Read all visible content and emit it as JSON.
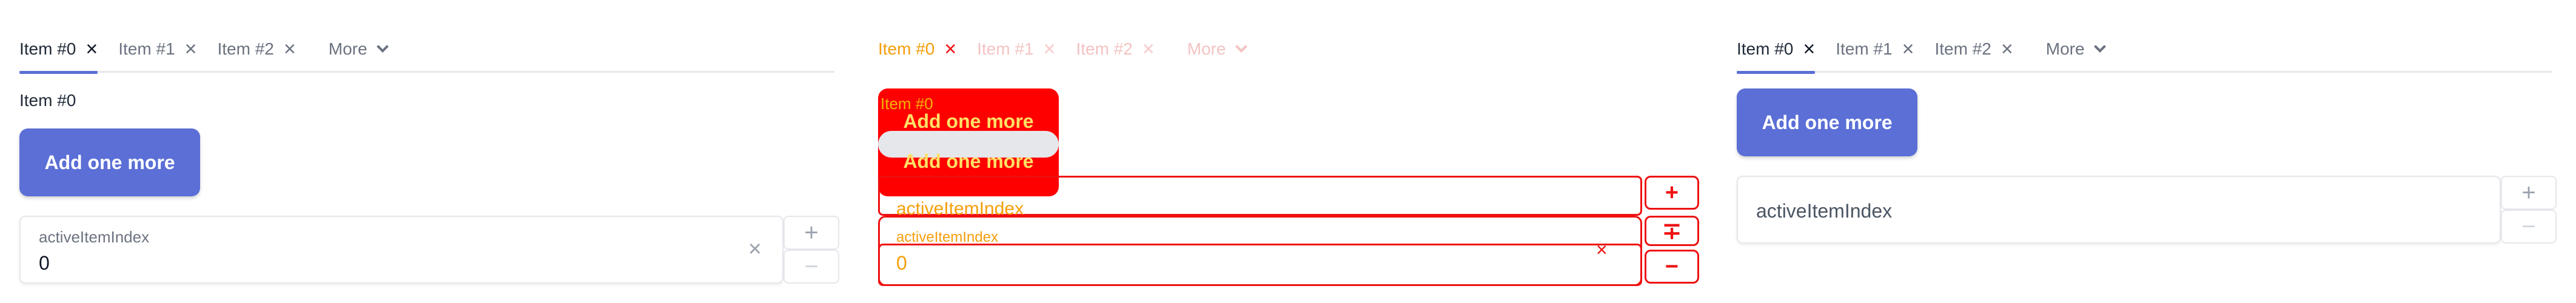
{
  "tabs": [
    {
      "label": "Item #0"
    },
    {
      "label": "Item #1"
    },
    {
      "label": "Item #2"
    }
  ],
  "more_label": "More",
  "add_button_label": "Add one more",
  "panel_a": {
    "content_label": "Item #0",
    "field_label": "activeItemIndex",
    "field_value": "0"
  },
  "panel_b": {
    "content_label": "Item #0",
    "button_label_1": "Add one more",
    "button_label_2": "Add one more",
    "field_label_1": "activeItemIndex",
    "field_label_2": "activeItemIndex",
    "field_value": "0"
  },
  "panel_c": {
    "field_placeholder": "activeItemIndex"
  },
  "colors": {
    "accent": "#5b6fd6",
    "debug_red": "#ef1010",
    "debug_text": "#f59e0b"
  },
  "icons": {
    "tab_close": "close-icon",
    "more": "chevron-down-icon",
    "clear": "clear-icon",
    "increment": "plus-icon",
    "decrement": "minus-icon"
  }
}
